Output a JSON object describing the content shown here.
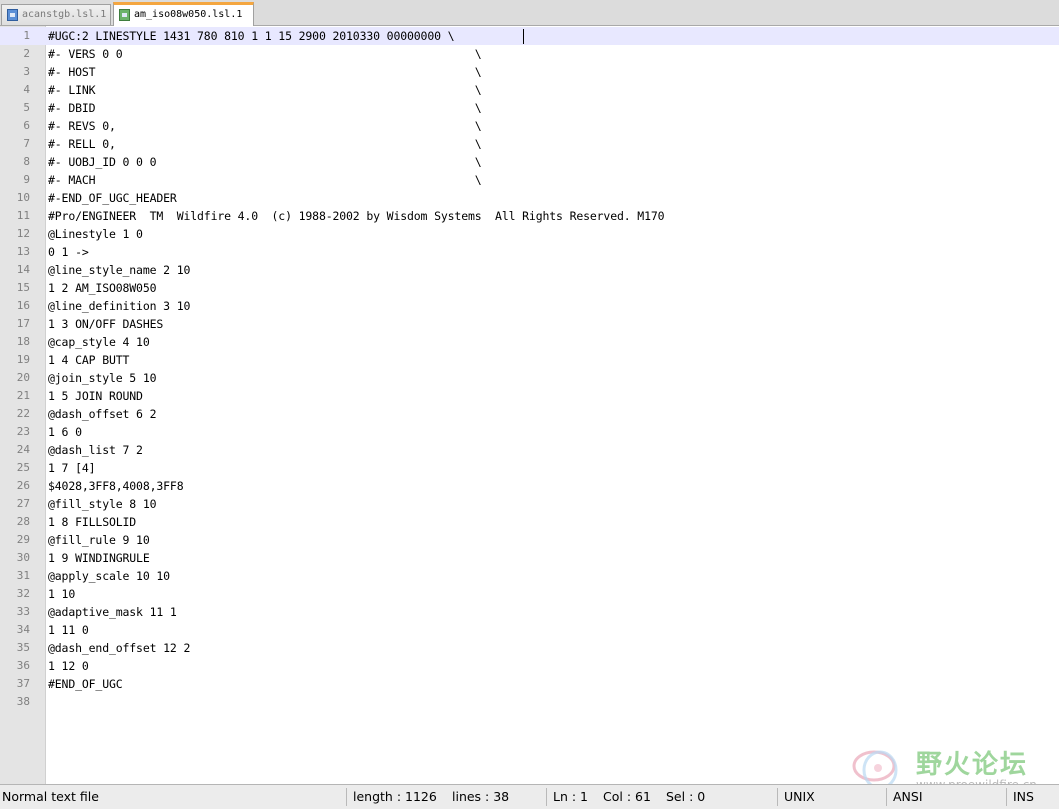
{
  "tabs": [
    {
      "label": "acanstgb.lsl.1",
      "active": false
    },
    {
      "label": "am_iso08w050.lsl.1",
      "active": true
    }
  ],
  "editor": {
    "current_line": 1,
    "lines": [
      "#UGC:2 LINESTYLE 1431 780 810 1 1 15 2900 2010330 00000000 \\",
      "#- VERS 0 0                                                    \\",
      "#- HOST                                                        \\",
      "#- LINK                                                        \\",
      "#- DBID                                                        \\",
      "#- REVS 0,                                                     \\",
      "#- RELL 0,                                                     \\",
      "#- UOBJ_ID 0 0 0                                               \\",
      "#- MACH                                                        \\",
      "#-END_OF_UGC_HEADER",
      "#Pro/ENGINEER  TM  Wildfire 4.0  (c) 1988-2002 by Wisdom Systems  All Rights Reserved. M170",
      "@Linestyle 1 0",
      "0 1 ->",
      "@line_style_name 2 10",
      "1 2 AM_ISO08W050",
      "@line_definition 3 10",
      "1 3 ON/OFF DASHES",
      "@cap_style 4 10",
      "1 4 CAP BUTT",
      "@join_style 5 10",
      "1 5 JOIN ROUND",
      "@dash_offset 6 2",
      "1 6 0",
      "@dash_list 7 2",
      "1 7 [4]",
      "$4028,3FF8,4008,3FF8",
      "@fill_style 8 10",
      "1 8 FILLSOLID",
      "@fill_rule 9 10",
      "1 9 WINDINGRULE",
      "@apply_scale 10 10",
      "1 10",
      "@adaptive_mask 11 1",
      "1 11 0",
      "@dash_end_offset 12 2",
      "1 12 0",
      "#END_OF_UGC",
      ""
    ]
  },
  "watermark": {
    "text": "野火论坛",
    "url": "www.proewildfire.cn",
    "color": "#8fd08c"
  },
  "statusbar": {
    "file_type": "Normal text file",
    "length": "length : 1126",
    "lines": "lines : 38",
    "ln": "Ln : 1",
    "col": "Col : 61",
    "sel": "Sel : 0",
    "eol": "UNIX",
    "encoding": "ANSI",
    "mode": "INS"
  },
  "colors": {
    "active_tab_accent": "#f4a640",
    "current_line": "#e8e8ff",
    "gutter": "#e4e4e4"
  }
}
